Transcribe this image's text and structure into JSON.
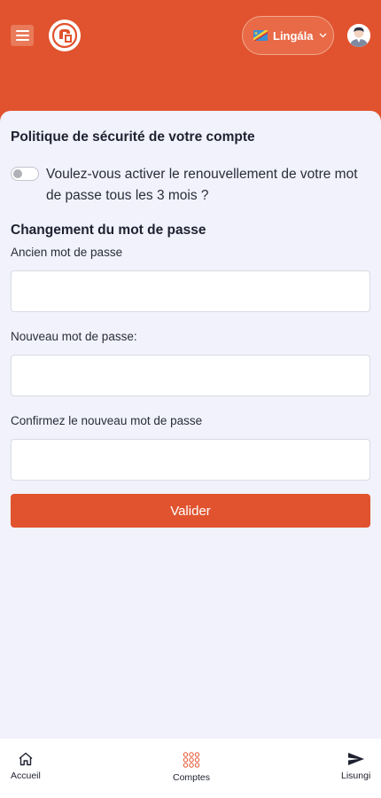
{
  "header": {
    "language_label": "Lingála",
    "menu_icon": "hamburger-menu-icon",
    "logo_icon": "app-logo",
    "avatar_icon": "user-avatar-icon",
    "brand_color": "#e0532e"
  },
  "security": {
    "title": "Politique de sécurité de votre compte",
    "toggle_text": "Voulez-vous activer le renouvellement de votre mot de passe tous les 3 mois ?",
    "toggle_on": false
  },
  "password_change": {
    "title": "Changement du mot de passe",
    "old_label": "Ancien mot de passe",
    "old_value": "",
    "new_label": "Nouveau mot de passe:",
    "new_value": "",
    "confirm_label": "Confirmez le nouveau mot de passe",
    "confirm_value": "",
    "submit_label": "Valider"
  },
  "bottom_nav": {
    "items": [
      {
        "label": "Accueil",
        "icon": "home-icon"
      },
      {
        "label": "Comptes",
        "icon": "accounts-grid-icon"
      },
      {
        "label": "Lisungi",
        "icon": "send-icon"
      }
    ]
  }
}
